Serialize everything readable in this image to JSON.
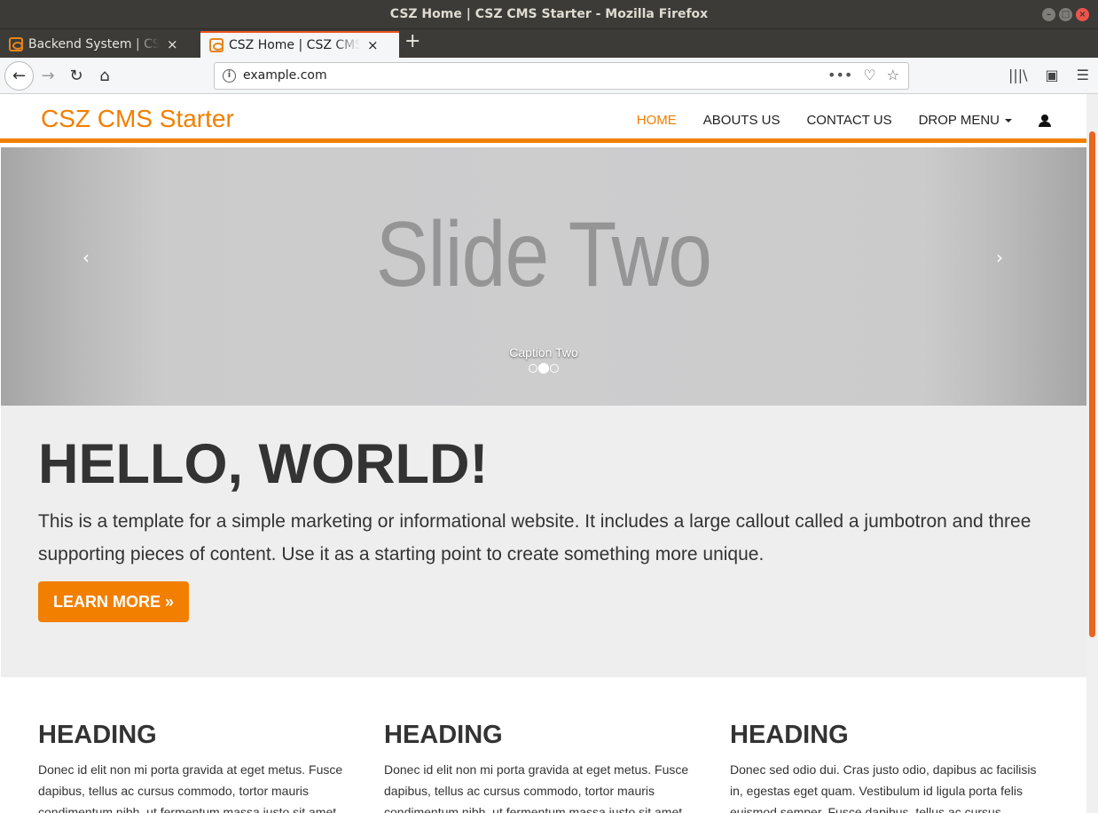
{
  "window": {
    "title": "CSZ Home | CSZ CMS Starter - Mozilla Firefox",
    "controls": [
      "–",
      "□",
      "×"
    ]
  },
  "tabs": [
    {
      "label": "Backend System | CSZ CMS Starter",
      "close": "×"
    },
    {
      "label": "CSZ Home | CSZ CMS Starter",
      "close": "×"
    }
  ],
  "toolbar": {
    "new_tab": "+",
    "back": "←",
    "forward": "→",
    "reload": "↻",
    "home": "⌂",
    "url": "example.com",
    "info": "i",
    "page_actions": "•••",
    "pocket": "♡",
    "bookmark": "☆",
    "library": "|||\\",
    "sidebar": "▣",
    "menu": "☰"
  },
  "site": {
    "brand": "CSZ CMS Starter",
    "nav": [
      "HOME",
      "ABOUTS US",
      "CONTACT US",
      "DROP MENU"
    ],
    "accent": "#f27f00"
  },
  "carousel": {
    "slide_text": "Slide Two",
    "caption": "Caption Two",
    "prev": "‹",
    "next": "›",
    "slide_count": 3,
    "active_index": 1
  },
  "jumbotron": {
    "heading": "HELLO, WORLD!",
    "body": "This is a template for a simple marketing or informational website. It includes a large callout called a jumbotron and three supporting pieces of content. Use it as a starting point to create something more unique.",
    "button": "LEARN MORE »"
  },
  "columns": [
    {
      "heading": "HEADING",
      "text": "Donec id elit non mi porta gravida at eget metus. Fusce dapibus, tellus ac cursus commodo, tortor mauris condimentum nibh, ut fermentum massa justo sit amet risus."
    },
    {
      "heading": "HEADING",
      "text": "Donec id elit non mi porta gravida at eget metus. Fusce dapibus, tellus ac cursus commodo, tortor mauris condimentum nibh, ut fermentum massa justo sit amet risus."
    },
    {
      "heading": "HEADING",
      "text": "Donec sed odio dui. Cras justo odio, dapibus ac facilisis in, egestas eget quam. Vestibulum id ligula porta felis euismod semper. Fusce dapibus, tellus ac cursus commodo."
    }
  ]
}
